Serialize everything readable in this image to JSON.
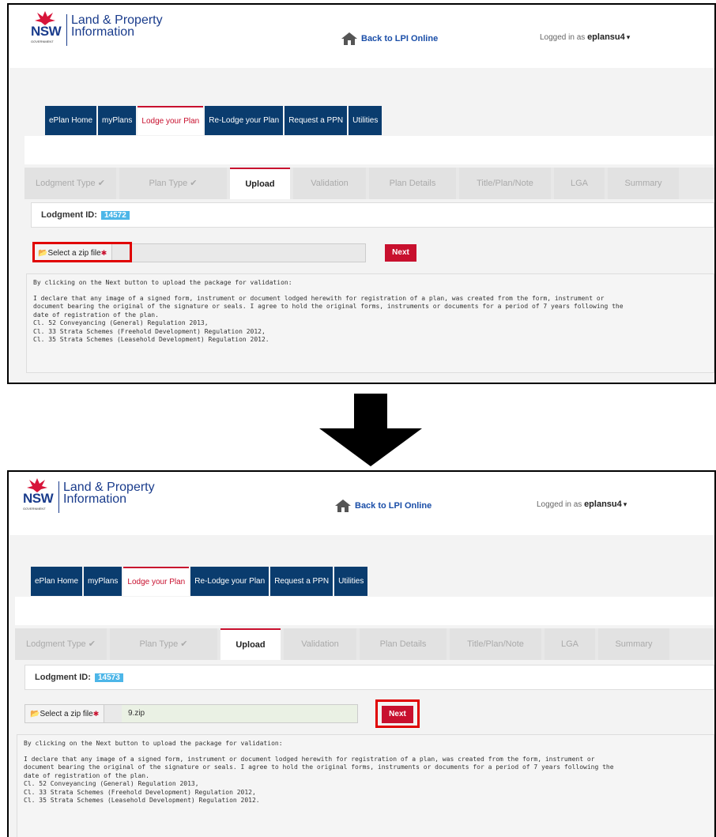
{
  "header": {
    "logo_nsw": "NSW",
    "logo_gov": "GOVERNMENT",
    "logo_line1": "Land & Property",
    "logo_line2": "Information",
    "back_link": "Back to LPI Online",
    "logged_in_label": "Logged in as",
    "username": "eplansu4"
  },
  "nav": [
    "ePlan Home",
    "myPlans",
    "Lodge your Plan",
    "Re-Lodge your Plan",
    "Request a PPN",
    "Utilities"
  ],
  "steps": [
    "Lodgment Type ✔",
    "Plan Type ✔",
    "Upload",
    "Validation",
    "Plan Details",
    "Title/Plan/Note",
    "LGA",
    "Summary"
  ],
  "lodgment_label": "Lodgment ID:",
  "file_label": "Select a zip file",
  "next_label": "Next",
  "declaration": {
    "lead": "By clicking on the Next button to upload the package for validation:",
    "l1": "I declare that any image of a signed form, instrument or document lodged herewith for registration of a plan, was created from the form, instrument or",
    "l2": "document bearing the original of the signature or seals. I agree to hold the original forms, instruments or documents for a period of 7 years following the",
    "l3": "date of registration of the plan.",
    "l4": "Cl. 52 Conveyancing (General) Regulation 2013,",
    "l5": "Cl. 33 Strata Schemes (Freehold Development) Regulation 2012,",
    "l6": "Cl. 35 Strata Schemes (Leasehold Development) Regulation 2012."
  },
  "before": {
    "lodgment_id": "14572",
    "file_value": ""
  },
  "after": {
    "lodgment_id": "14573",
    "file_value": "9.zip"
  },
  "colors": {
    "nav_bg": "#0a3c6e",
    "accent_red": "#c8102e",
    "id_badge": "#4db6e8",
    "highlight": "#e00000"
  },
  "icons": [
    "waratah-logo",
    "home-icon",
    "folder-icon",
    "down-arrow"
  ]
}
